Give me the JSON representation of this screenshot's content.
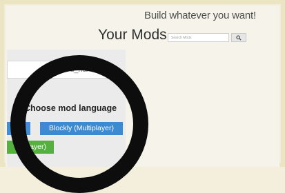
{
  "header": {
    "tagline": "Build whatever you want!",
    "title": "Your Mods"
  },
  "search": {
    "placeholder": "Search Mods",
    "button_icon": "search-icon"
  },
  "form": {
    "name_placeholder": "mod_name_here",
    "language_label": "Choose mod language",
    "buttons": {
      "left_partial": ")",
      "blockly_multiplayer": "Blockly (Multiplayer)",
      "green_partial": "layer)"
    }
  },
  "colors": {
    "background": "#f2eedd",
    "panel": "#ebebeb",
    "blue_button": "#3c8ad2",
    "green_button": "#55b040",
    "ring": "#0d0d0d"
  }
}
